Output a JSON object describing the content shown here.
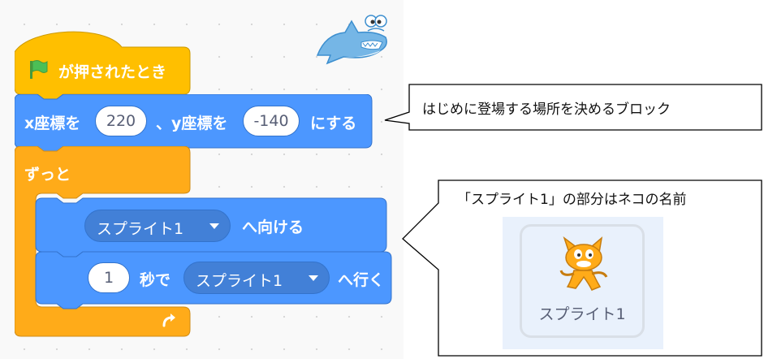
{
  "blocks": {
    "hat": {
      "label": "が押されたとき",
      "icon": "green-flag-icon"
    },
    "goto_xy": {
      "label_x": "x座標を",
      "x_value": "220",
      "label_y": "、y座標を",
      "y_value": "-140",
      "label_end": "にする"
    },
    "forever": {
      "label": "ずっと",
      "loop_icon": "loop-arrow-icon"
    },
    "point_towards": {
      "target": "スプライト1",
      "label": "へ向ける"
    },
    "glide": {
      "seconds": "1",
      "label_sec": "秒で",
      "target": "スプライト1",
      "label": "へ行く"
    }
  },
  "callouts": {
    "top": "はじめに登場する場所を決めるブロック",
    "bottom": "「スプライト1」の部分はネコの名前"
  },
  "sprite_tile": {
    "name": "スプライト1",
    "icon": "cat-sprite-icon"
  },
  "decor": {
    "icon": "shark-icon"
  },
  "colors": {
    "events": "#ffbf00",
    "motion": "#4c97ff",
    "control": "#ffab19",
    "sprite_panel": "#e9f1fc"
  }
}
